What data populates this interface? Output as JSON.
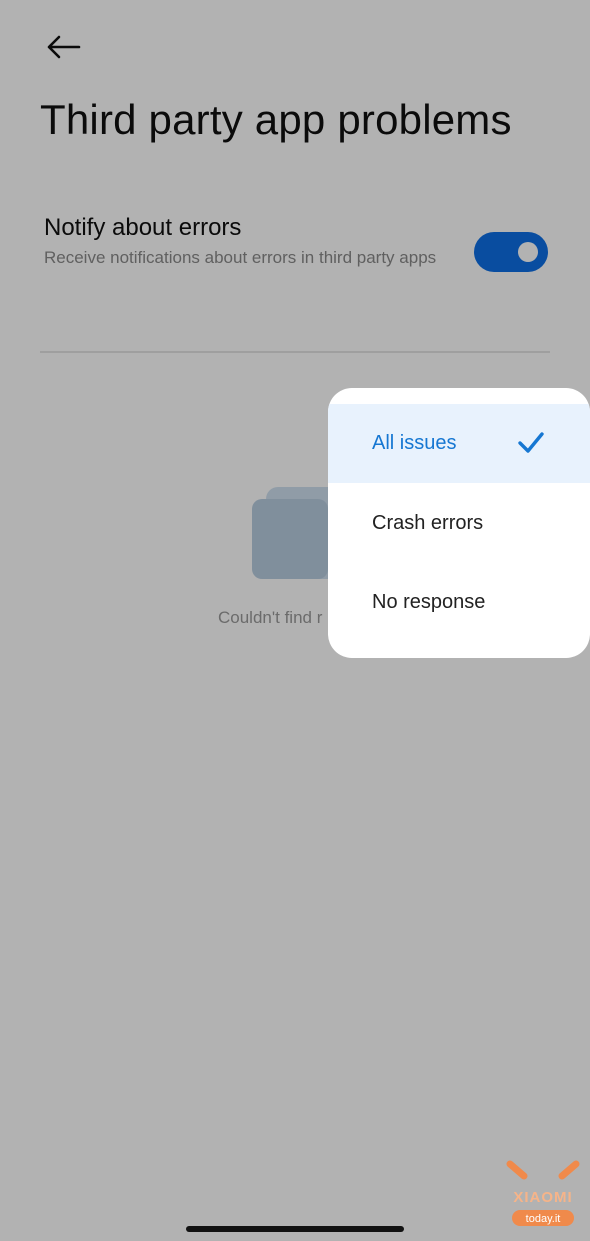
{
  "header": {
    "back_icon": "arrow-left-icon",
    "title": "Third party app problems"
  },
  "setting": {
    "title": "Notify about errors",
    "description": "Receive notifications about errors in third party apps",
    "toggle_on": true,
    "toggle_color": "#0d6fe6"
  },
  "empty_state": {
    "icon": "empty-documents-icon",
    "text": "Couldn't find r"
  },
  "dropdown": {
    "items": [
      {
        "label": "All issues",
        "selected": true
      },
      {
        "label": "Crash errors",
        "selected": false
      },
      {
        "label": "No response",
        "selected": false
      }
    ],
    "check_icon": "checkmark-icon",
    "accent_color": "#1677d2"
  },
  "watermark": {
    "brand": "XIAOMI",
    "site": "today.it",
    "color": "#f08a4b"
  }
}
